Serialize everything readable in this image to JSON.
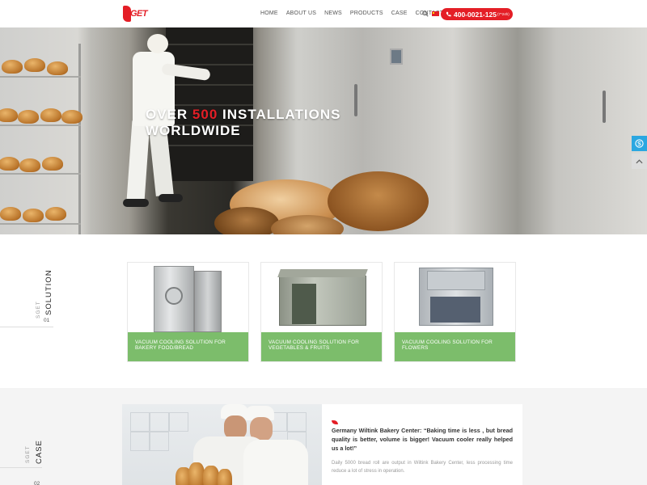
{
  "header": {
    "logo_text": "GET",
    "nav": [
      {
        "label": "HOME"
      },
      {
        "label": "ABOUT US"
      },
      {
        "label": "NEWS"
      },
      {
        "label": "PRODUCTS"
      },
      {
        "label": "CASE"
      },
      {
        "label": "CONTACT US"
      }
    ],
    "phone": "400-0021-125",
    "phone_hours": "(7*24h)"
  },
  "hero": {
    "title_prefix": "OVER ",
    "title_highlight": "500",
    "title_suffix": " INSTALLATIONS",
    "title_line2": "WORLDWIDE"
  },
  "solution": {
    "section_title": "SOLUTION",
    "section_sub": "SGET",
    "section_num": "01",
    "cards": [
      {
        "caption": "VACUUM COOLING SOLUTION FOR BAKERY FOOD/BREAD"
      },
      {
        "caption": "VACUUM COOLING SOLUTION FOR VEGETABLES & FRUITS"
      },
      {
        "caption": "VACUUM COOLING SOLUTION FOR FLOWERS"
      }
    ]
  },
  "case": {
    "section_title": "CASE",
    "section_sub": "SGET",
    "section_num": "02",
    "title": "Germany Wiltink Bakery Center: “Baking time is less , but bread quality is better, volume is bigger! Vacuum cooler really helped us a lot!”",
    "desc": "Daily 5000 bread roll are output in Wiltink Bakery Center, less processing time reduce a lot of stress in operation."
  },
  "colors": {
    "brand_red": "#e41e26",
    "card_green": "#7cbd6b",
    "skype_blue": "#2ba7e1"
  },
  "icons": [
    "search-icon",
    "flag-icon",
    "phone-icon",
    "skype-icon",
    "back-to-top-icon",
    "leaf-icon"
  ]
}
